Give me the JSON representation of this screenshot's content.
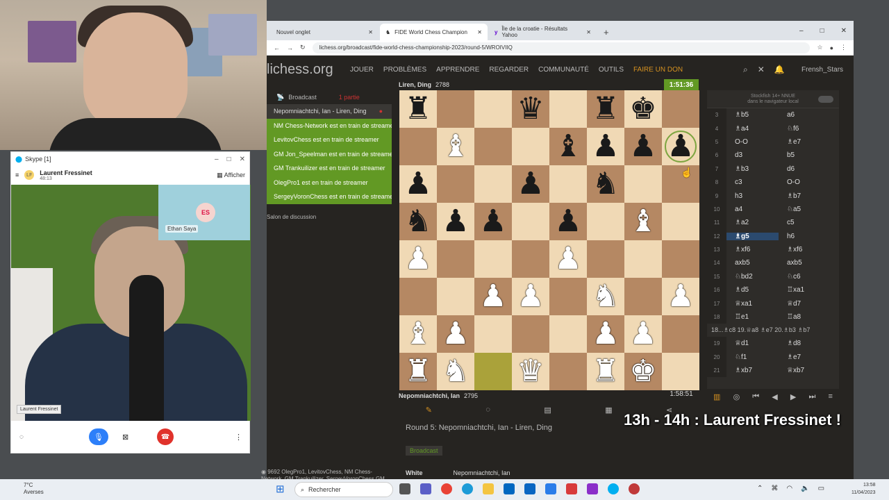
{
  "skype": {
    "title": "Skype [1]",
    "caller_initials": "LF",
    "caller_name": "Laurent Fressinet",
    "duration": "48:13",
    "afficher": "Afficher",
    "thumb_initials": "ES",
    "thumb_name": "Ethan Saya",
    "self_label": "Laurent Fressinet"
  },
  "browser": {
    "tabs": [
      {
        "label": "Nouvel onglet"
      },
      {
        "label": "FIDE World Chess Champion"
      },
      {
        "label": "Île de la croatie - Résultats Yahoo"
      }
    ],
    "url": "lichess.org/broadcast/fide-world-chess-championship-2023/round-5/WROIVIIQ"
  },
  "lichess": {
    "logo": "lichess.org",
    "nav": [
      "JOUER",
      "PROBLÈMES",
      "APPRENDRE",
      "REGARDER",
      "COMMUNAUTÉ",
      "OUTILS"
    ],
    "donate": "FAIRE UN DON",
    "user": "Frensh_Stars"
  },
  "broadcast": {
    "label": "Broadcast",
    "partie": "1 partie",
    "games": [
      "Nepomniachtchi, Ian - Liren, Ding"
    ],
    "streamers": [
      "NM Chess-Network est en train de streamer",
      "LevitovChess est en train de streamer",
      "GM Jon_Speelman est en train de streamer",
      "GM Trankuilizer est en train de streamer",
      "OlegPro1 est en train de streamer",
      "SergeyVoronChess est en train de streamer"
    ],
    "salon": "Salon de discussion",
    "spectators_count": "9692",
    "spectators": "OlegPro1, LevitovChess, NM Chess-Network, GM Trankuilizer, SergeyVoronChess GM Jon_Speelman"
  },
  "game": {
    "black_name": "Liren, Ding",
    "black_rating": "2788",
    "black_clock": "1:51:36",
    "white_name": "Nepomniachtchi, Ian",
    "white_rating": "2795",
    "white_clock": "1:58:51",
    "title": "Round 5: Nepomniachtchi, Ian - Liren, Ding",
    "badge": "Broadcast",
    "white_label": "White",
    "white_value": "Nepomniachtchi, Ian",
    "board": [
      [
        "r",
        "",
        "",
        "q",
        "",
        "r",
        "k",
        ""
      ],
      [
        "",
        "B",
        "",
        "",
        "b",
        "p",
        "p",
        "p"
      ],
      [
        "p",
        "",
        "",
        "p",
        "",
        "n",
        "",
        ""
      ],
      [
        "n",
        "p",
        "p",
        "",
        "p",
        "",
        "B",
        ""
      ],
      [
        "P",
        "",
        "",
        "",
        "P",
        "",
        "",
        ""
      ],
      [
        "",
        "",
        "P",
        "P",
        "",
        "N",
        "",
        "P"
      ],
      [
        "B",
        "P",
        "",
        "",
        "",
        "P",
        "P",
        ""
      ],
      [
        "R",
        "N",
        "",
        "Q",
        "",
        "R",
        "K",
        ""
      ]
    ]
  },
  "engine": {
    "line1": "Stockfish 14+ NNUE",
    "line2": "dans le navigateur local"
  },
  "moves": [
    {
      "n": "3",
      "w": "♗b5",
      "b": "a6"
    },
    {
      "n": "4",
      "w": "♗a4",
      "b": "♘f6"
    },
    {
      "n": "5",
      "w": "O-O",
      "b": "♗e7"
    },
    {
      "n": "6",
      "w": "d3",
      "b": "b5"
    },
    {
      "n": "7",
      "w": "♗b3",
      "b": "d6"
    },
    {
      "n": "8",
      "w": "c3",
      "b": "O-O"
    },
    {
      "n": "9",
      "w": "h3",
      "b": "♗b7"
    },
    {
      "n": "10",
      "w": "a4",
      "b": "♘a5"
    },
    {
      "n": "11",
      "w": "♗a2",
      "b": "c5"
    },
    {
      "n": "12",
      "w": "♗g5",
      "b": "h6"
    },
    {
      "n": "13",
      "w": "♗xf6",
      "b": "♗xf6"
    },
    {
      "n": "14",
      "w": "axb5",
      "b": "axb5"
    },
    {
      "n": "15",
      "w": "♘bd2",
      "b": "♘c6"
    },
    {
      "n": "16",
      "w": "♗d5",
      "b": "♖xa1"
    },
    {
      "n": "17",
      "w": "♕xa1",
      "b": "♕d7"
    },
    {
      "n": "18",
      "w": "♖e1",
      "b": "♖a8"
    }
  ],
  "move_comment": "18...♗c8 19.♕a8 ♗e7 20.♗b3 ♗b7",
  "moves_after": [
    {
      "n": "19",
      "w": "♕d1",
      "b": "♗d8"
    },
    {
      "n": "20",
      "w": "♘f1",
      "b": "♗e7"
    },
    {
      "n": "21",
      "w": "♗xb7",
      "b": "♕xb7"
    }
  ],
  "overlay": "13h - 14h : Laurent Fressinet !",
  "taskbar": {
    "temp": "7°C",
    "weather": "Averses",
    "search": "Rechercher",
    "time": "13:58",
    "date": "11/04/2023"
  },
  "colors": {
    "lichess_green": "#629924",
    "board_light": "#f0d9b5",
    "board_dark": "#b58863",
    "skype_blue": "#2d7ff9"
  }
}
